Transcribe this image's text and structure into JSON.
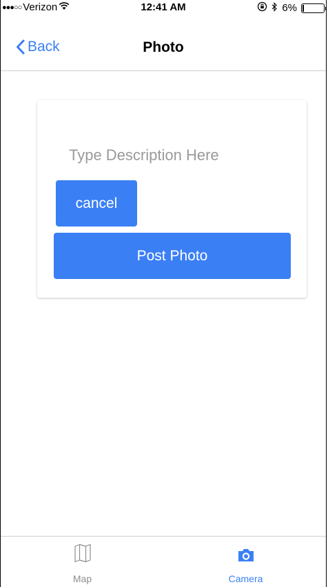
{
  "status_bar": {
    "carrier": "Verizon",
    "signal_dots": "●●●○○",
    "time": "12:41 AM",
    "battery_percent": "6%",
    "battery_level": 0.06
  },
  "nav": {
    "back_label": "Back",
    "title": "Photo"
  },
  "form": {
    "description_placeholder": "Type Description Here",
    "description_value": "",
    "cancel_label": "cancel",
    "post_label": "Post Photo"
  },
  "tabs": [
    {
      "label": "Map",
      "icon": "map-icon",
      "active": false
    },
    {
      "label": "Camera",
      "icon": "camera-icon",
      "active": true
    }
  ],
  "colors": {
    "accent": "#3b7ff5",
    "tab_inactive": "#8e8e8e"
  }
}
